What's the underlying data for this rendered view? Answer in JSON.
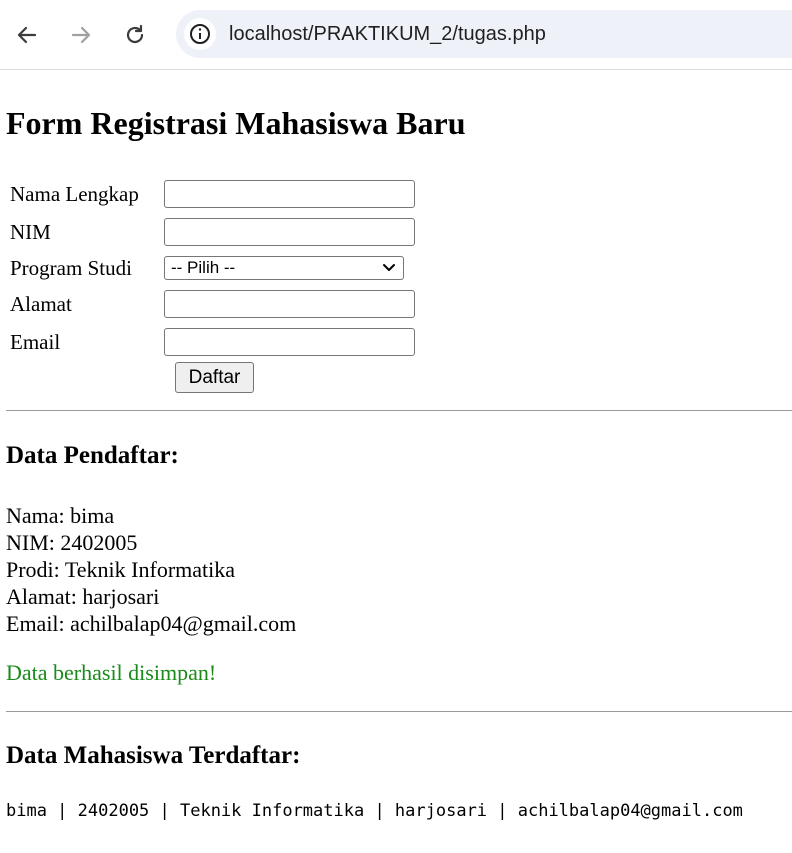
{
  "browser": {
    "url": "localhost/PRAKTIKUM_2/tugas.php"
  },
  "page": {
    "title": "Form Registrasi Mahasiswa Baru",
    "form": {
      "fields": [
        {
          "label": "Nama Lengkap",
          "value": ""
        },
        {
          "label": "NIM",
          "value": ""
        },
        {
          "label": "Program Studi",
          "selected": "-- Pilih --"
        },
        {
          "label": "Alamat",
          "value": ""
        },
        {
          "label": "Email",
          "value": ""
        }
      ],
      "submit_label": "Daftar"
    },
    "registrant": {
      "heading": "Data Pendaftar:",
      "lines": [
        "Nama: bima",
        "NIM: 2402005",
        "Prodi: Teknik Informatika",
        "Alamat: harjosari",
        "Email: achilbalap04@gmail.com"
      ],
      "success_message": "Data berhasil disimpan!"
    },
    "registered": {
      "heading": "Data Mahasiswa Terdaftar:",
      "rows": [
        "bima | 2402005 | Teknik Informatika | harjosari | achilbalap04@gmail.com"
      ]
    }
  }
}
